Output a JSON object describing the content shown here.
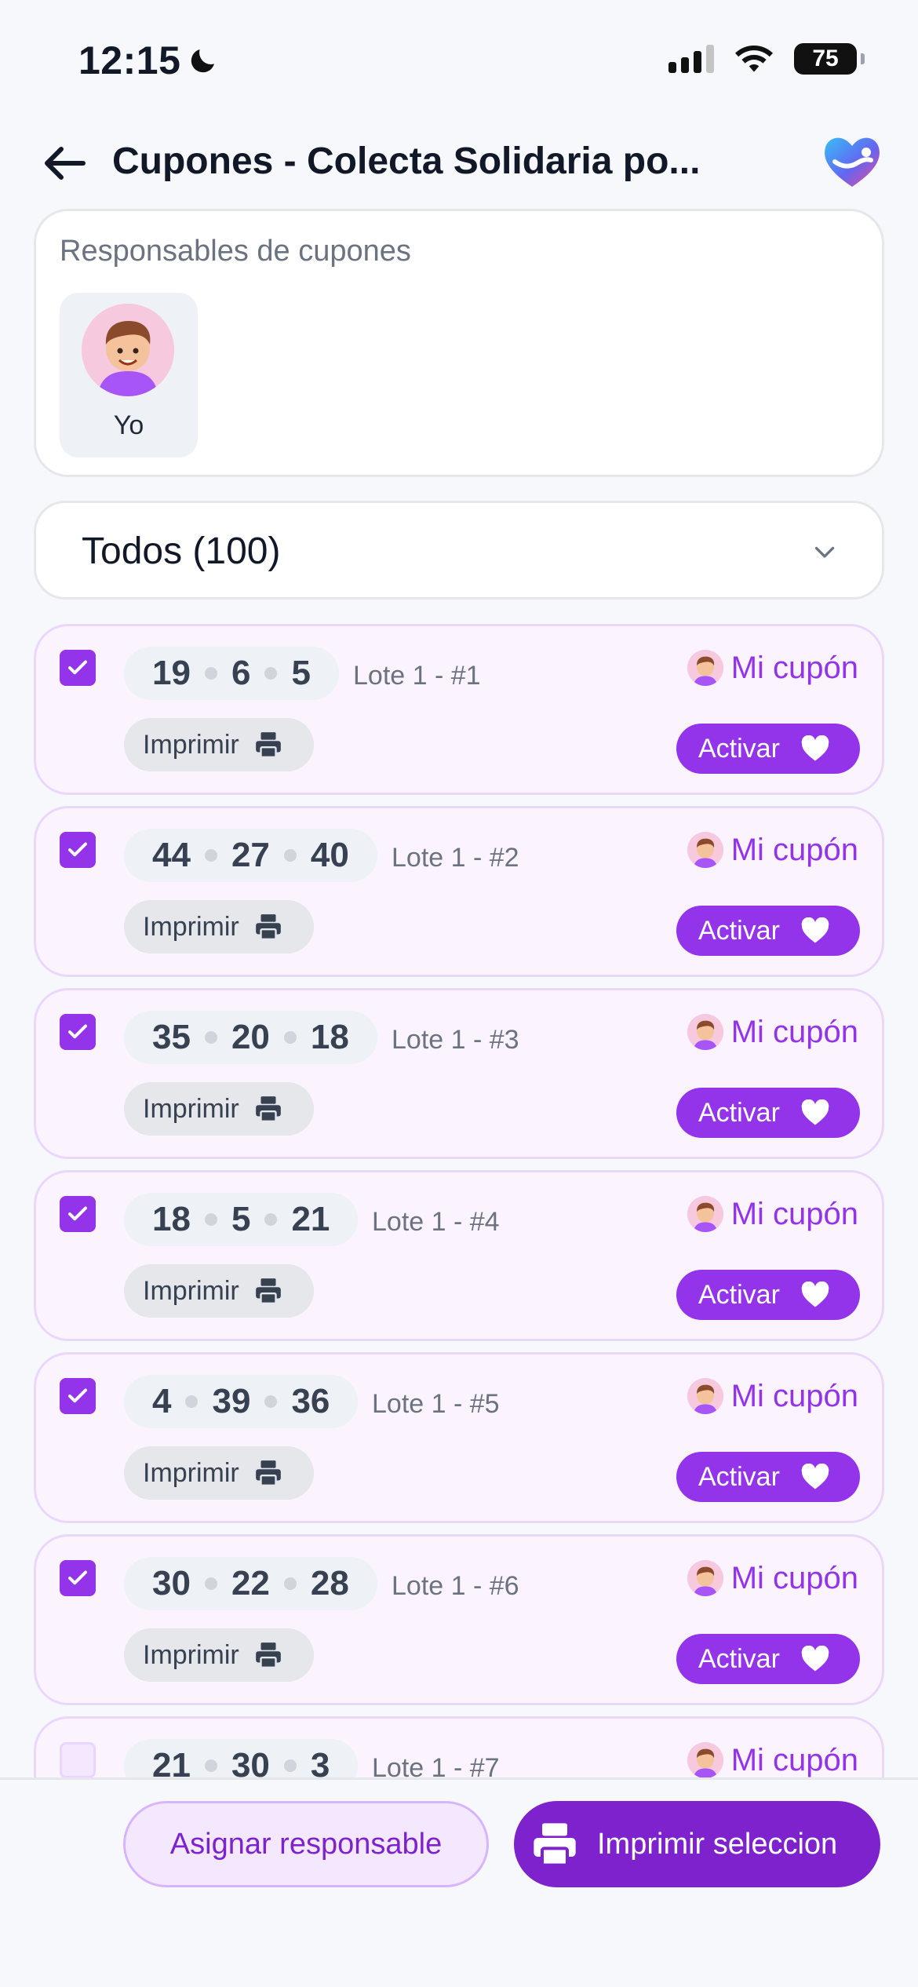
{
  "status_bar": {
    "time": "12:15",
    "battery": "75"
  },
  "header": {
    "title": "Cupones - Colecta Solidaria po..."
  },
  "responsables": {
    "label": "Responsables de cupones",
    "people": [
      {
        "name": "Yo"
      }
    ]
  },
  "filter": {
    "label": "Todos (100)"
  },
  "coupon_labels": {
    "print": "Imprimir",
    "activate": "Activar",
    "mine": "Mi cupón"
  },
  "coupons": [
    {
      "n1": "19",
      "n2": "6",
      "n3": "5",
      "lote": "Lote 1 - #1",
      "checked": true
    },
    {
      "n1": "44",
      "n2": "27",
      "n3": "40",
      "lote": "Lote 1 - #2",
      "checked": true
    },
    {
      "n1": "35",
      "n2": "20",
      "n3": "18",
      "lote": "Lote 1 - #3",
      "checked": true
    },
    {
      "n1": "18",
      "n2": "5",
      "n3": "21",
      "lote": "Lote 1 - #4",
      "checked": true
    },
    {
      "n1": "4",
      "n2": "39",
      "n3": "36",
      "lote": "Lote 1 - #5",
      "checked": true
    },
    {
      "n1": "30",
      "n2": "22",
      "n3": "28",
      "lote": "Lote 1 - #6",
      "checked": true
    },
    {
      "n1": "21",
      "n2": "30",
      "n3": "3",
      "lote": "Lote 1 - #7",
      "checked": false
    }
  ],
  "bottom_bar": {
    "assign_label": "Asignar responsable",
    "print_selection_label": "Imprimir seleccion"
  },
  "colors": {
    "accent": "#9333ea",
    "accent_dark": "#7e22ce",
    "card_bg": "#fbf4ff",
    "page_bg": "#f7f8fc"
  }
}
